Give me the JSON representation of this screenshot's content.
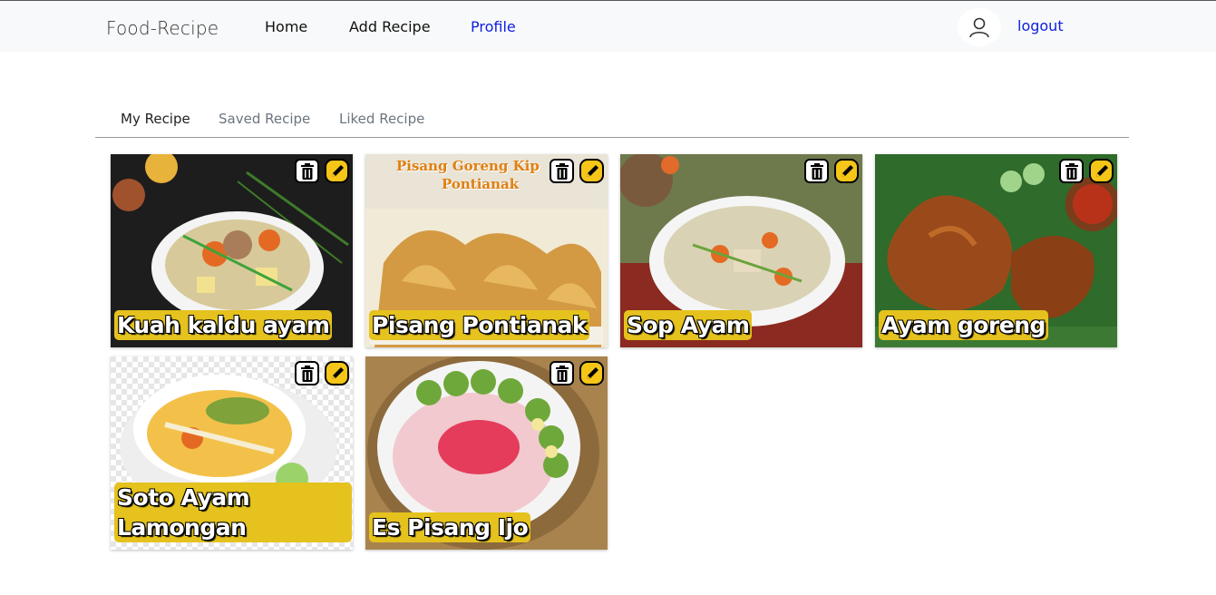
{
  "brand": "Food-Recipe",
  "nav": {
    "home": "Home",
    "add_recipe": "Add Recipe",
    "profile": "Profile",
    "logout": "logout"
  },
  "tabs": {
    "my": "My Recipe",
    "saved": "Saved Recipe",
    "liked": "Liked Recipe"
  },
  "recipes": [
    {
      "title": "Kuah kaldu ayam",
      "icon": "soup-bowl-image"
    },
    {
      "title": "Pisang Pontianak",
      "icon": "fried-banana-image",
      "image_text_1": "Pisang Goreng Kip",
      "image_text_2": "Pontianak"
    },
    {
      "title": "Sop Ayam",
      "icon": "soup-bowl-image"
    },
    {
      "title": "Ayam goreng",
      "icon": "fried-chicken-image"
    },
    {
      "title": "Soto Ayam Lamongan",
      "icon": "soup-bowl-image"
    },
    {
      "title": "Es Pisang Ijo",
      "icon": "dessert-bowl-image"
    }
  ],
  "colors": {
    "accent": "#0d1fe0",
    "title_bg": "#e5c21d",
    "edit_btn": "#f5c518",
    "highlight": "#f2e33b"
  }
}
